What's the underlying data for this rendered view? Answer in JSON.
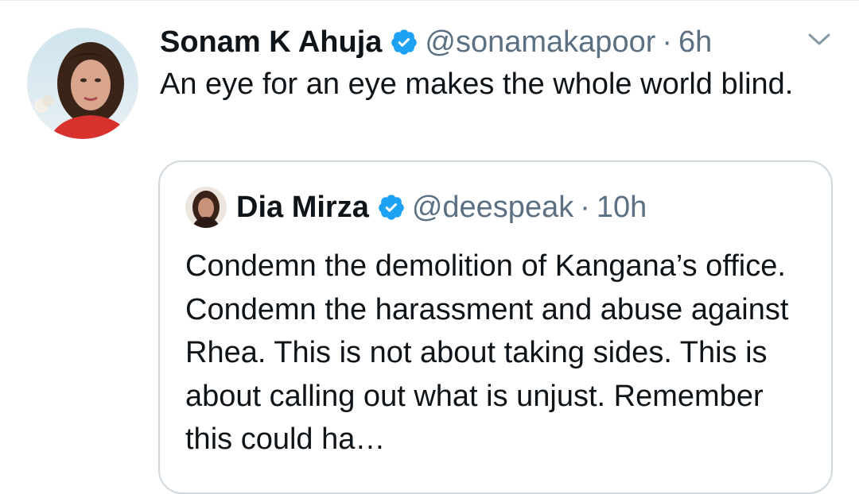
{
  "tweet": {
    "author_name": "Sonam K Ahuja",
    "handle": "@sonamakapoor",
    "separator": "·",
    "time": "6h",
    "text": "An eye for an eye makes the whole world blind."
  },
  "quoted_tweet": {
    "author_name": "Dia Mirza",
    "handle": "@deespeak",
    "separator": "·",
    "time": "10h",
    "text": "Condemn the demolition of Kangana’s office. Condemn the harassment and abuse against Rhea. This is not about taking sides. This is about calling out what is unjust. Remember this could ha…"
  },
  "colors": {
    "verified": "#1da1f2",
    "secondary_text": "#5b7083",
    "card_border": "#cfd9de"
  },
  "icons": {
    "verified": "verified-badge-icon",
    "more": "chevron-down-icon"
  }
}
